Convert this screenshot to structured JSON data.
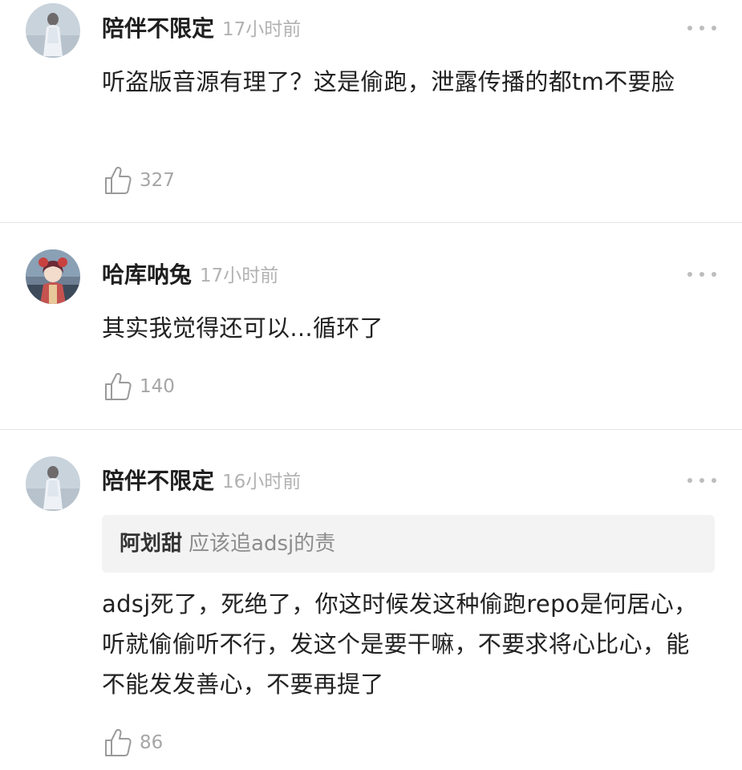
{
  "comments": [
    {
      "username": "陪伴不限定",
      "time": "17小时前",
      "text": "听盗版音源有理了？这是偷跑，泄露传播的都tm不要脸",
      "likes": "327"
    },
    {
      "username": "哈库呐兔",
      "time": "17小时前",
      "text": "其实我觉得还可以...循环了",
      "likes": "140"
    },
    {
      "username": "陪伴不限定",
      "time": "16小时前",
      "quote": {
        "user": "阿划甜",
        "text": "应该追adsj的责"
      },
      "text": "adsj死了，死绝了，你这时候发这种偷跑repo是何居心，听就偷偷听不行，发这个是要干嘛，不要求将心比心，能不能发发善心，不要再提了",
      "likes": "86"
    }
  ],
  "icons": {
    "like": "thumbs-up-icon",
    "more": "more-dots-icon"
  },
  "colors": {
    "username": "#1f1f1f",
    "time": "#b2b2b2",
    "text": "#222222",
    "quote_bg": "#f3f3f3",
    "quote_text": "#8c8c8c",
    "meta": "#a6a6a6",
    "divider": "#e4e4e4"
  }
}
